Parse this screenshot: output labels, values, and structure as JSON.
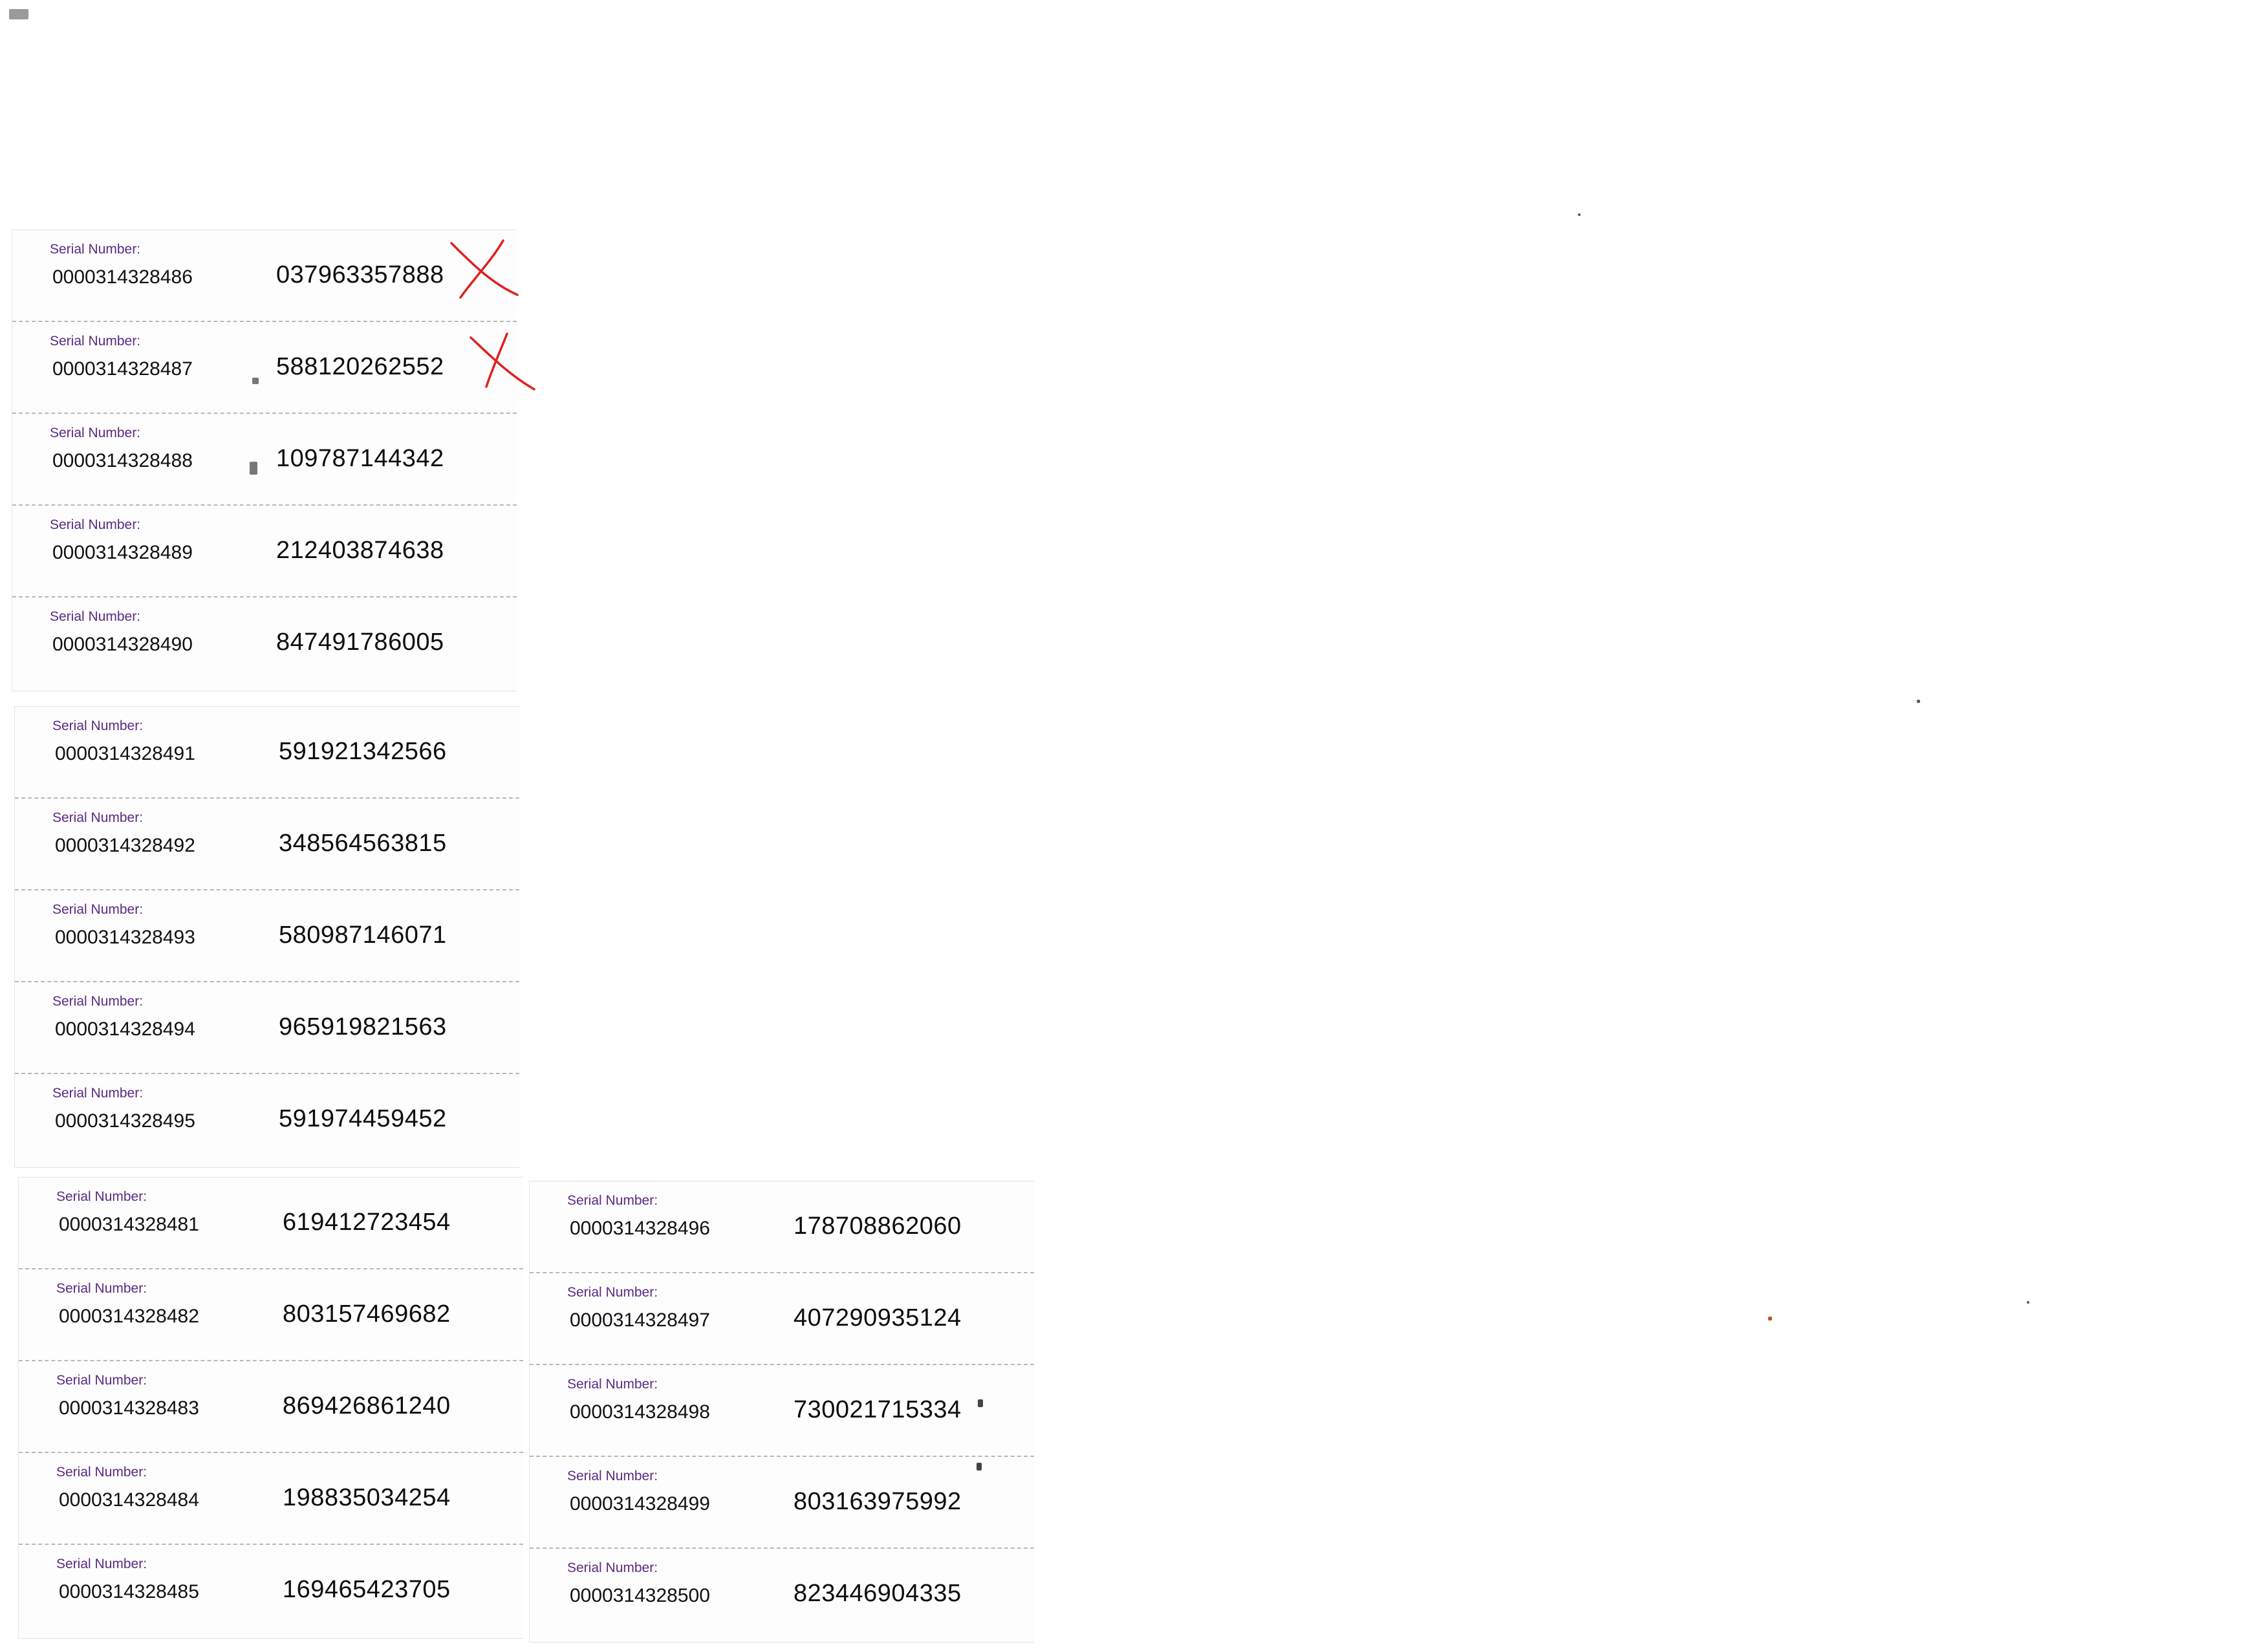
{
  "cards": {
    "block1": [
      {
        "label": "Serial Number:",
        "serial": "0000314328486",
        "pin": "037963357888"
      },
      {
        "label": "Serial Number:",
        "serial": "0000314328487",
        "pin": "588120262552"
      },
      {
        "label": "Serial Number:",
        "serial": "0000314328488",
        "pin": "109787144342"
      },
      {
        "label": "Serial Number:",
        "serial": "0000314328489",
        "pin": "212403874638"
      },
      {
        "label": "Serial Number:",
        "serial": "0000314328490",
        "pin": "847491786005"
      }
    ],
    "block2": [
      {
        "label": "Serial Number:",
        "serial": "0000314328491",
        "pin": "591921342566"
      },
      {
        "label": "Serial Number:",
        "serial": "0000314328492",
        "pin": "348564563815"
      },
      {
        "label": "Serial Number:",
        "serial": "0000314328493",
        "pin": "580987146071"
      },
      {
        "label": "Serial Number:",
        "serial": "0000314328494",
        "pin": "965919821563"
      },
      {
        "label": "Serial Number:",
        "serial": "0000314328495",
        "pin": "591974459452"
      }
    ],
    "block3": [
      {
        "label": "Serial Number:",
        "serial": "0000314328481",
        "pin": "619412723454"
      },
      {
        "label": "Serial Number:",
        "serial": "0000314328482",
        "pin": "803157469682"
      },
      {
        "label": "Serial Number:",
        "serial": "0000314328483",
        "pin": "869426861240"
      },
      {
        "label": "Serial Number:",
        "serial": "0000314328484",
        "pin": "198835034254"
      },
      {
        "label": "Serial Number:",
        "serial": "0000314328485",
        "pin": "169465423705"
      }
    ],
    "block4": [
      {
        "label": "Serial Number:",
        "serial": "0000314328496",
        "pin": "178708862060"
      },
      {
        "label": "Serial Number:",
        "serial": "0000314328497",
        "pin": "407290935124"
      },
      {
        "label": "Serial Number:",
        "serial": "0000314328498",
        "pin": "730021715334"
      },
      {
        "label": "Serial Number:",
        "serial": "0000314328499",
        "pin": "803163975992"
      },
      {
        "label": "Serial Number:",
        "serial": "0000314328500",
        "pin": "823446904335"
      }
    ]
  },
  "marks": {
    "cross_color": "#e02020",
    "crossed_serials": [
      "0000314328486",
      "0000314328487"
    ]
  },
  "colors": {
    "label": "#5a2a82",
    "text": "#111111",
    "paper": "#fdfdfd"
  }
}
